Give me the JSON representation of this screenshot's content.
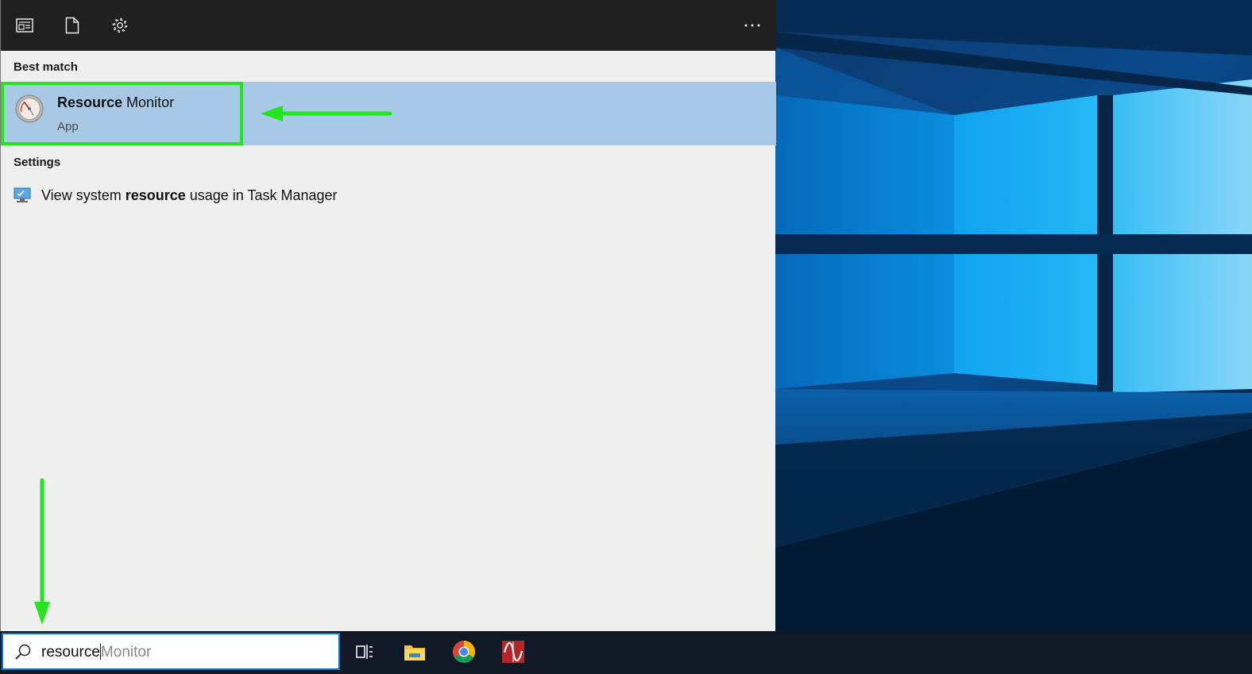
{
  "toolbar": {
    "icons": [
      "news-icon",
      "document-icon",
      "gear-icon",
      "more-icon"
    ]
  },
  "best_match": {
    "header": "Best match",
    "app_title_bold": "Resource",
    "app_title_rest": " Monitor",
    "app_type": "App",
    "icon": "resource-monitor-icon"
  },
  "settings": {
    "header": "Settings",
    "item_prefix": "View system ",
    "item_bold": "resource",
    "item_suffix": " usage in Task Manager",
    "item_icon": "monitor-icon"
  },
  "taskbar": {
    "search_typed": "resource",
    "search_suggestion": "Monitor",
    "icons": [
      "task-view-icon",
      "file-explorer-icon",
      "chrome-icon",
      "resource-monitor-taskbar-icon"
    ]
  },
  "colors": {
    "highlight_row": "#a8c9e6",
    "annotation_green": "#22e61c",
    "taskbar": "#0f1a26",
    "search_border": "#0078d7"
  }
}
